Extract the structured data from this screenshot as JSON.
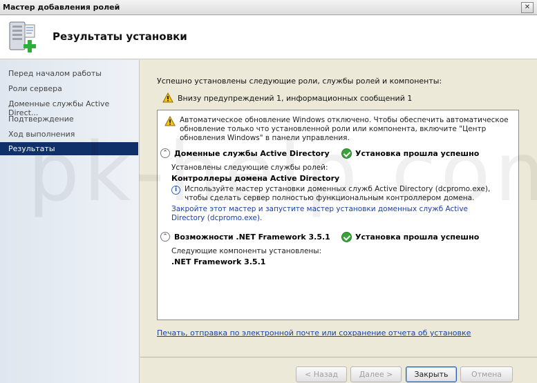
{
  "window": {
    "title": "Мастер добавления ролей",
    "close_glyph": "✕"
  },
  "header": {
    "title": "Результаты установки"
  },
  "sidebar": {
    "items": [
      {
        "label": "Перед началом работы"
      },
      {
        "label": "Роли сервера"
      },
      {
        "label": "Доменные службы Active Direct..."
      },
      {
        "label": "Подтверждение"
      },
      {
        "label": "Ход выполнения"
      },
      {
        "label": "Результаты",
        "active": true
      }
    ]
  },
  "main": {
    "summary": "Успешно установлены следующие роли, службы ролей и компоненты:",
    "warnings": "Внизу предупреждений 1, информационных сообщений 1",
    "results": {
      "note": "Автоматическое обновление Windows отключено. Чтобы обеспечить автоматическое обновление только что установленной роли или компонента, включите \"Центр обновления Windows\" в панели управления.",
      "sections": [
        {
          "title": "Доменные службы Active Directory",
          "status": "Установка прошла успешно",
          "installed_label": "Установлены следующие службы ролей:",
          "installed_item": "Контроллеры домена Active Directory",
          "info": "Используйте мастер установки доменных служб Active Directory (dcpromo.exe), чтобы сделать сервер полностью функциональным контроллером домена.",
          "link": "Закройте этот мастер и запустите мастер установки доменных служб Active Directory (dcpromo.exe)."
        },
        {
          "title": "Возможности .NET Framework 3.5.1",
          "status": "Установка прошла успешно",
          "installed_label": "Следующие компоненты установлены:",
          "installed_item": ".NET Framework 3.5.1"
        }
      ]
    },
    "report_link": "Печать, отправка по электронной почте или сохранение отчета об установке"
  },
  "buttons": {
    "back": "< Назад",
    "next": "Далее >",
    "close": "Закрыть",
    "cancel": "Отмена"
  },
  "watermark": "pk-help.com",
  "colors": {
    "accent": "#10306a",
    "link": "#1a3ea8",
    "success": "#3aa23a"
  }
}
